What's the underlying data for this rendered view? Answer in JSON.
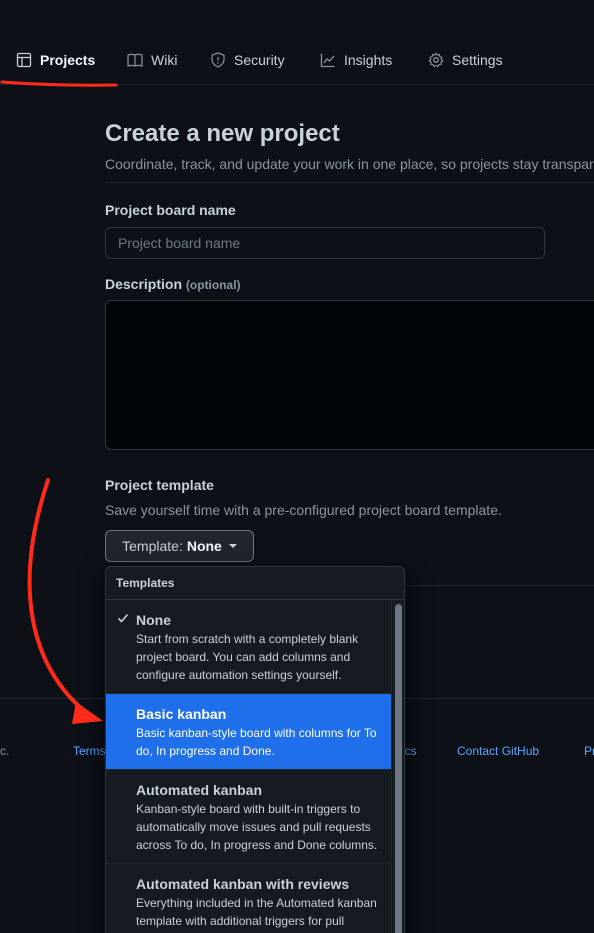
{
  "tabs": [
    {
      "label": "Projects",
      "icon": "project-table-icon",
      "selected": true
    },
    {
      "label": "Wiki",
      "icon": "book-icon",
      "selected": false
    },
    {
      "label": "Security",
      "icon": "shield-icon",
      "selected": false
    },
    {
      "label": "Insights",
      "icon": "graph-icon",
      "selected": false
    },
    {
      "label": "Settings",
      "icon": "gear-icon",
      "selected": false
    }
  ],
  "form": {
    "title": "Create a new project",
    "subtitle": "Coordinate, track, and update your work in one place, so projects stay transparent and on schedule.",
    "name_label": "Project board name",
    "name_placeholder": "Project board name",
    "name_value": "",
    "description_label": "Description",
    "description_optional": "(optional)",
    "description_value": "",
    "template_label": "Project template",
    "template_hint": "Save yourself time with a pre-configured project board template.",
    "template_button_prefix": "Template:",
    "template_button_value": "None"
  },
  "dropdown": {
    "header": "Templates",
    "items": [
      {
        "name": "None",
        "desc": "Start from scratch with a completely blank project board. You can add columns and configure automation settings yourself.",
        "checked": true,
        "active": false
      },
      {
        "name": "Basic kanban",
        "desc": "Basic kanban-style board with columns for To do, In progress and Done.",
        "checked": false,
        "active": true
      },
      {
        "name": "Automated kanban",
        "desc": "Kanban-style board with built-in triggers to automatically move issues and pull requests across To do, In progress and Done columns.",
        "checked": false,
        "active": false
      },
      {
        "name": "Automated kanban with reviews",
        "desc": "Everything included in the Automated kanban template with additional triggers for pull request reviews.",
        "checked": false,
        "active": false
      }
    ]
  },
  "footer": {
    "copyright_fragment": "c.",
    "terms": "Terms",
    "docs_fragment": "ics",
    "contact": "Contact GitHub",
    "pricing_fragment": "Pr"
  },
  "colors": {
    "background": "#0d1117",
    "accent_blue": "#1f6feb",
    "link_blue": "#58a6ff",
    "annotation_red": "#ff2a1a"
  }
}
